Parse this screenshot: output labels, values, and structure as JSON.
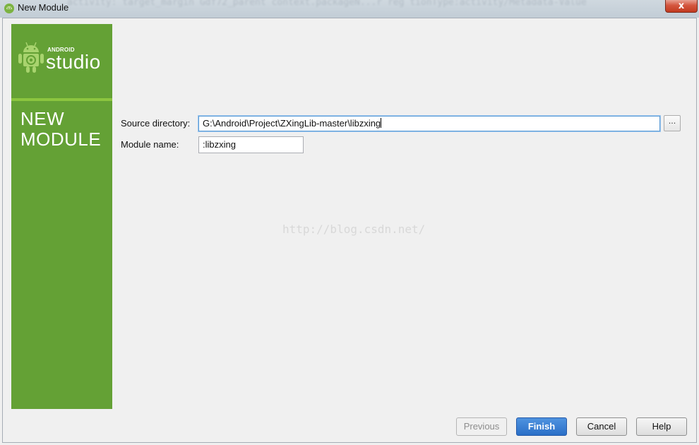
{
  "window": {
    "title": "New Module",
    "close_label": "x",
    "background_code": "activity: target_margin  Gdf72_parent  context.packageN...r  reg    tionType:activity/Metadata-Value"
  },
  "sidebar": {
    "logo_small": "ANDROID",
    "logo_large": "studio",
    "heading_line1": "NEW",
    "heading_line2": "MODULE",
    "color": "#64a135"
  },
  "form": {
    "source_directory_label": "Source directory:",
    "source_directory_value": "G:\\Android\\Project\\ZXingLib-master\\libzxing",
    "browse_label": "...",
    "module_name_label": "Module name:",
    "module_name_value": ":libzxing"
  },
  "watermark": "http://blog.csdn.net/",
  "buttons": {
    "previous": "Previous",
    "finish": "Finish",
    "cancel": "Cancel",
    "help": "Help"
  }
}
